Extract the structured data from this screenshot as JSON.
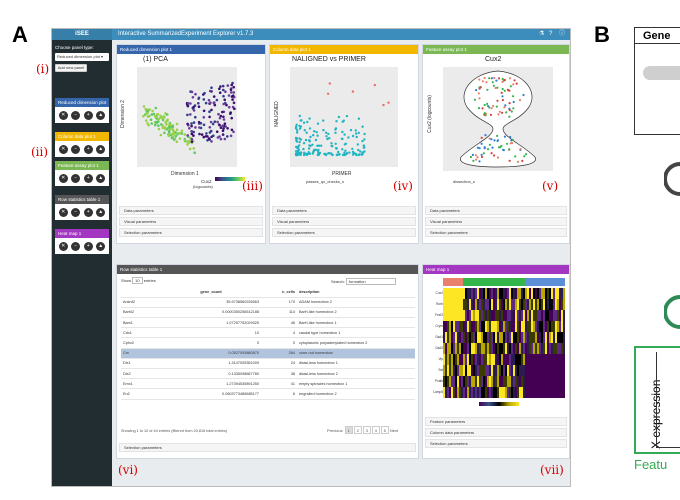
{
  "figure_labels": {
    "a": "A",
    "b": "B"
  },
  "roman": {
    "i": "(i)",
    "ii": "(ii)",
    "iii": "(iii)",
    "iv": "(iv)",
    "v": "(v)",
    "vi": "(vi)",
    "vii": "(vii)"
  },
  "app": {
    "logo": "iSEE",
    "title": "Interactive SummarizedExperiment Explorer v1.7.3",
    "icons": [
      "flask-icon",
      "question-icon",
      "info-icon"
    ]
  },
  "sidebar": {
    "choose_label": "Choose panel type:",
    "choose_value": "Reduced dimension plot",
    "add_button": "Add new panel",
    "entries": [
      {
        "label": "Reduced dimension plot 1",
        "color": "#3565AA"
      },
      {
        "label": "Column data plot 1",
        "color": "#F2B701"
      },
      {
        "label": "Feature assay plot 1",
        "color": "#7BB854"
      },
      {
        "label": "Row statistics table 1",
        "color": "#E73F7A"
      },
      {
        "label": "Heat map 1",
        "color": "#A437C1"
      }
    ]
  },
  "panels": {
    "redDim": {
      "header": "Reduced dimension plot 1",
      "color": "#3565AA",
      "title": "(1) PCA",
      "xlabel": "Dimension 1",
      "ylabel": "Dimension 2",
      "legend_title": "Cux2",
      "legend_sub": "(logcounts)",
      "params": [
        "Data parameters",
        "Visual parameters",
        "Selection parameters"
      ]
    },
    "colData": {
      "header": "Column data plot 1",
      "color": "#F2B701",
      "title": "NALIGNED vs PRIMER",
      "xlabel": "PRIMER",
      "ylabel": "NALIGNED",
      "legend": "passes_qc_checks_s",
      "params": [
        "Data parameters",
        "Visual parameters",
        "Selection parameters"
      ]
    },
    "featAssay": {
      "header": "Feature assay plot 1",
      "color": "#7BB854",
      "title": "Cux2",
      "ylabel": "Cux2 (logcounts)",
      "legend": "dissection_s",
      "params": [
        "Data parameters",
        "Visual parameters",
        "Selection parameters"
      ]
    },
    "rowStats": {
      "header": "Row statistics table 1",
      "color": "#E73F7A",
      "show_label": "Show",
      "show_value": "10",
      "entries_label": "entries",
      "search_label": "Search:",
      "search_value": "formation",
      "columns": [
        "",
        "gene_count",
        "n_cells",
        "description"
      ],
      "rows": [
        [
          "Ankrd2",
          "35.9738560226563",
          "170",
          "ADAM homeobox 2"
        ],
        [
          "Barhl2",
          "0.0000350256512188",
          "114",
          "BarH-like homeobox 2"
        ],
        [
          "Barx1",
          "1.07297752029325",
          "46",
          "BarH-like homeobox 1"
        ],
        [
          "Cdx1",
          "10",
          "4",
          "caudal type homeobox 1"
        ],
        [
          "Cphx2",
          "0",
          "0",
          "cytoplasmic polyadenylated homeobox 2"
        ],
        [
          "Crx",
          "0.0527093880870",
          "264",
          "cone-rod homeobox"
        ],
        [
          "Dlx1",
          "1.3147005351009",
          "24",
          "distal-less homeobox 1"
        ],
        [
          "Dlx2",
          "0.1335098667780",
          "38",
          "distal-less homeobox 2"
        ],
        [
          "Emx1",
          "1.27394535891250",
          "41",
          "empty spiracles homeobox 1"
        ],
        [
          "En2",
          "0.0603773486685177",
          "6",
          "engrailed homeobox 2"
        ]
      ],
      "info": "Showing 1 to 10 of 44 entries (filtered from 20,816 total entries)",
      "prev": "Previous",
      "pages": [
        "1",
        "2",
        "3",
        "4",
        "5"
      ],
      "next": "Next",
      "params": [
        "Selection parameters"
      ]
    },
    "heatmap": {
      "header": "Heat map 1",
      "color": "#A437C1",
      "genes": [
        "Cux2",
        "Rorb",
        "Fezf2",
        "Crym",
        "Gad1",
        "Gad2",
        "Vip",
        "Sst",
        "Pvalb",
        "Lamp5"
      ],
      "params": [
        "Feature parameters",
        "Column data parameters",
        "Selection parameters"
      ]
    }
  },
  "right_column": {
    "header_text": "Gene",
    "y_label": "X expression",
    "footer": "Featu"
  }
}
